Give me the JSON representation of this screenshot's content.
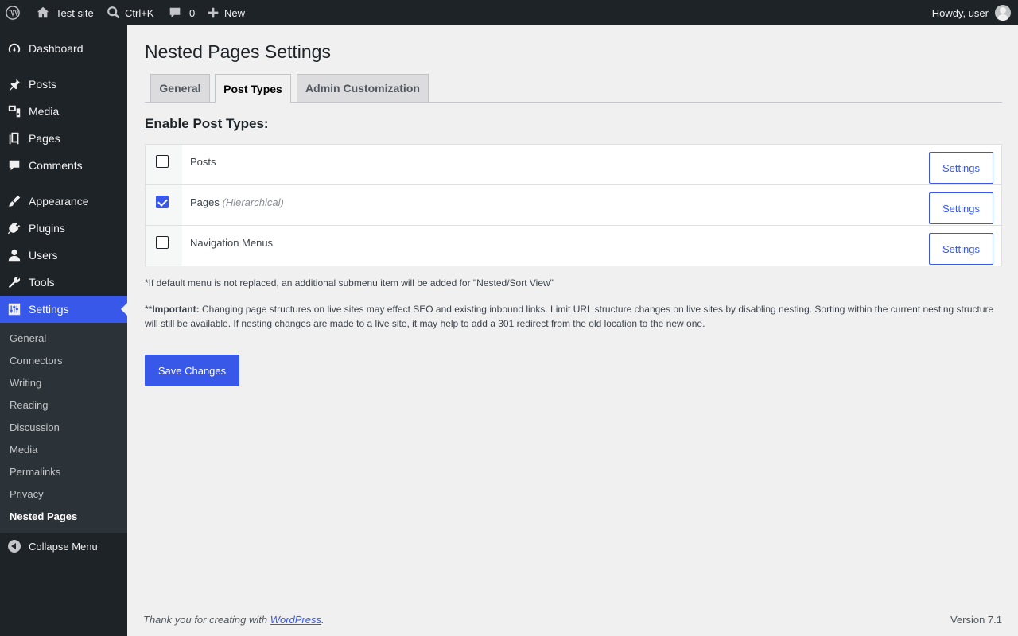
{
  "admin_bar": {
    "site_name": "Test site",
    "search_shortcut": "Ctrl+K",
    "comments_count": "0",
    "new_label": "New",
    "howdy": "Howdy, user"
  },
  "sidebar": {
    "items": [
      {
        "label": "Dashboard",
        "icon": "dashboard-icon"
      },
      {
        "label": "Posts",
        "icon": "pin-icon"
      },
      {
        "label": "Media",
        "icon": "media-icon"
      },
      {
        "label": "Pages",
        "icon": "pages-icon"
      },
      {
        "label": "Comments",
        "icon": "comment-icon"
      },
      {
        "label": "Appearance",
        "icon": "brush-icon"
      },
      {
        "label": "Plugins",
        "icon": "plug-icon"
      },
      {
        "label": "Users",
        "icon": "user-icon"
      },
      {
        "label": "Tools",
        "icon": "wrench-icon"
      },
      {
        "label": "Settings",
        "icon": "sliders-icon",
        "active": true
      }
    ],
    "submenu": [
      "General",
      "Connectors",
      "Writing",
      "Reading",
      "Discussion",
      "Media",
      "Permalinks",
      "Privacy",
      "Nested Pages"
    ],
    "submenu_current": "Nested Pages",
    "collapse_label": "Collapse Menu"
  },
  "page": {
    "title": "Nested Pages Settings",
    "tabs": [
      {
        "label": "General",
        "active": false
      },
      {
        "label": "Post Types",
        "active": true
      },
      {
        "label": "Admin Customization",
        "active": false
      }
    ],
    "section_title": "Enable Post Types:",
    "post_types": [
      {
        "label": "Posts",
        "qualifier": "",
        "checked": false,
        "button": "Settings"
      },
      {
        "label": "Pages",
        "qualifier": "(Hierarchical)",
        "checked": true,
        "button": "Settings"
      },
      {
        "label": "Navigation Menus",
        "qualifier": "",
        "checked": false,
        "button": "Settings"
      }
    ],
    "note_default_menu": "*If default menu is not replaced, an additional submenu item will be added for \"Nested/Sort View\"",
    "important_prefix": "**",
    "important_label": "Important:",
    "important_text": " Changing page structures on live sites may effect SEO and existing inbound links. Limit URL structure changes on live sites by disabling nesting. Sorting within the current nesting structure will still be available. If nesting changes are made to a live site, it may help to add a 301 redirect from the old location to the new one.",
    "save_button": "Save Changes"
  },
  "footer": {
    "thanks_prefix": "Thank you for creating with ",
    "wp_link": "WordPress",
    "thanks_suffix": ".",
    "version": "Version 7.1"
  },
  "colors": {
    "accent": "#3858e9",
    "admin_dark": "#1d2327",
    "background": "#f0f0f1"
  }
}
